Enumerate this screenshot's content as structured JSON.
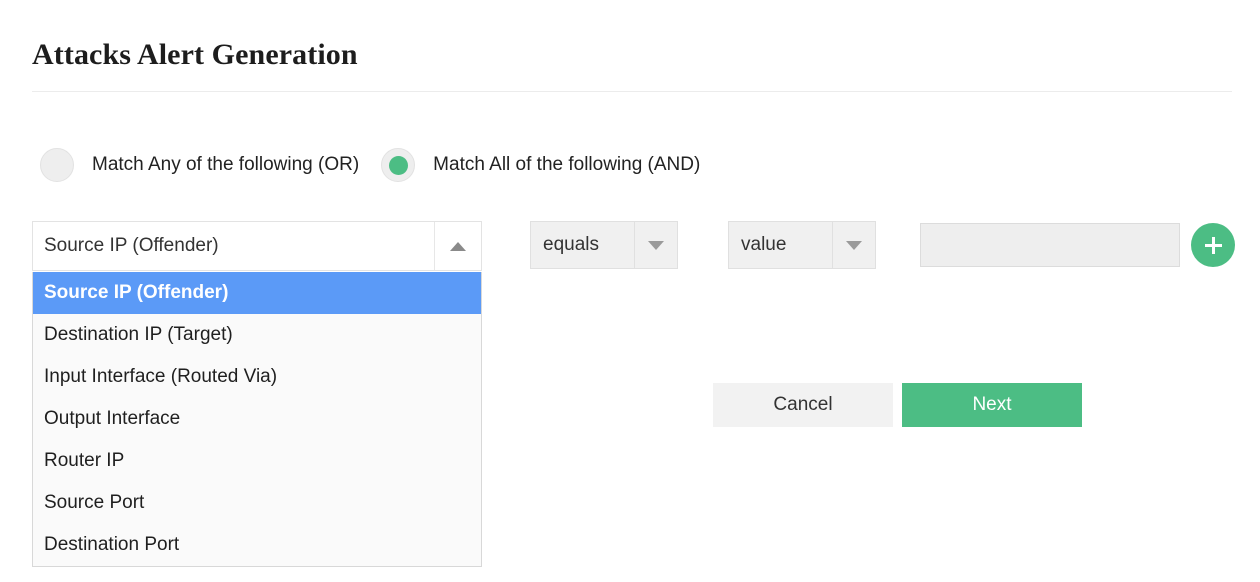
{
  "page": {
    "title": "Attacks Alert Generation"
  },
  "match_mode": {
    "options": [
      {
        "label": "Match Any of the following (OR)",
        "selected": false
      },
      {
        "label": "Match All of the following (AND)",
        "selected": true
      }
    ]
  },
  "condition": {
    "field_select": {
      "selected": "Source IP (Offender)",
      "arrow_icon": "caret-up-icon",
      "open": true,
      "options": [
        "Source IP (Offender)",
        "Destination IP (Target)",
        "Input Interface (Routed Via)",
        "Output Interface",
        "Router IP",
        "Source Port",
        "Destination Port"
      ]
    },
    "operator_select": {
      "selected": "equals",
      "arrow_icon": "caret-down-icon"
    },
    "value_select": {
      "selected": "value",
      "arrow_icon": "caret-down-icon"
    },
    "value_input": {
      "value": "",
      "placeholder": ""
    },
    "add_button": {
      "icon": "plus-icon"
    }
  },
  "footer": {
    "cancel_label": "Cancel",
    "next_label": "Next"
  },
  "colors": {
    "accent_green": "#4cbd84",
    "highlight_blue": "#5b9af7",
    "field_gray": "#eeeeee",
    "list_bg": "#fafafa"
  }
}
